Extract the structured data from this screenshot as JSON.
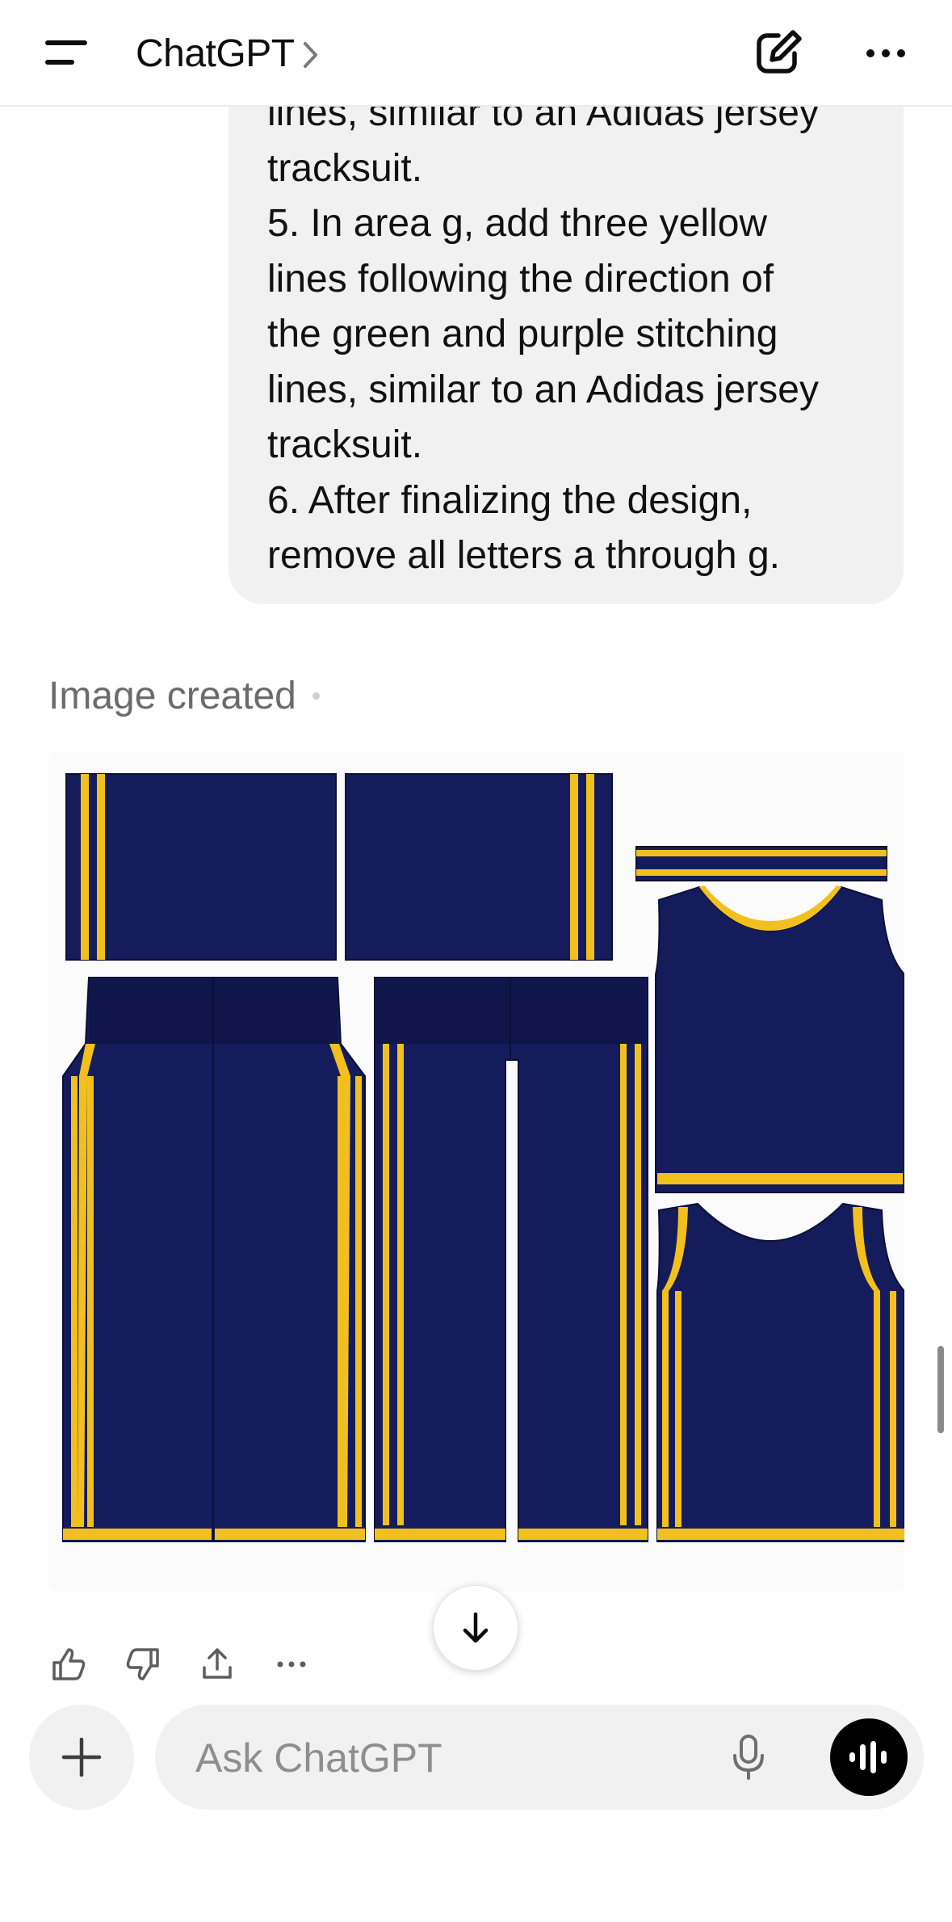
{
  "header": {
    "title": "ChatGPT",
    "menu_icon": "menu-icon",
    "new_chat_icon": "edit-icon",
    "more_icon": "more-icon"
  },
  "message": {
    "text": "lines, similar to an Adidas jersey\ntracksuit.\n5. In area g, add three yellow\nlines following the direction of\nthe green and purple stitching\nlines, similar to an Adidas jersey\ntracksuit.\n6. After finalizing the design,\nremove all letters a through g."
  },
  "response": {
    "label": "Image created"
  },
  "actions": [
    "thumbs-up-icon",
    "thumbs-down-icon",
    "share-icon",
    "more-icon"
  ],
  "composer": {
    "placeholder": "Ask ChatGPT"
  },
  "colors": {
    "navy": "#151c5c",
    "yellow": "#f2c01e",
    "bubble": "#f1f1f1"
  }
}
